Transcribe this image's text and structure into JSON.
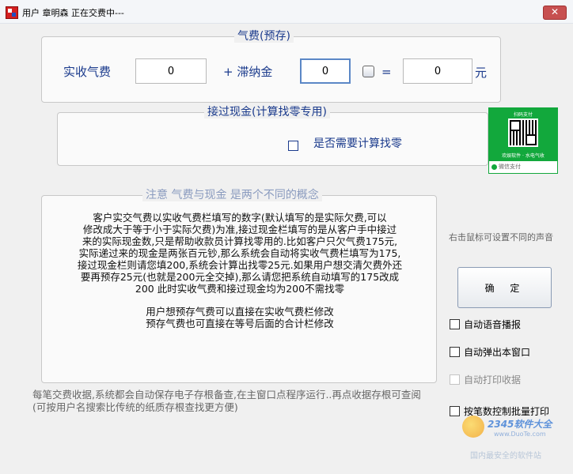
{
  "window": {
    "title": "用户 章明森 正在交费中---",
    "close_label": "✕"
  },
  "gas": {
    "group_title": "气费(预存)",
    "received_label": "实收气费",
    "received_value": "0",
    "late_fee_label": "+ 滞纳金",
    "late_fee_value": "0",
    "equals": "=",
    "total_value": "0",
    "unit": "元"
  },
  "cash": {
    "group_title": "接过现金(计算找零专用)",
    "change_label": "是否需要计算找零"
  },
  "qr": {
    "top_text": "扫码支付",
    "bottom_text": "欢娱软件 · 水电气收",
    "strip_text": "微信支付"
  },
  "notice": {
    "group_title": "注意 气费与现金 是两个不同的概念",
    "lines": [
      "客户实交气费以实收气费栏填写的数字(默认填写的是实际欠费,可以",
      "修改成大于等于小于实际欠费)为准,接过现金栏填写的是从客户手中接过",
      "来的实际现金数,只是帮助收款员计算找零用的.比如客户只欠气费175元,",
      "实际递过来的现金是两张百元钞,那么系统会自动将实收气费栏填写为175,",
      "接过现金栏则请您填200,系统会计算出找零25元.如果用户想交清欠费外还",
      "要再预存25元(也就是200元全交掉),那么请您把系统自动填写的175改成",
      "200 此时实收气费和接过现金均为200不需找零"
    ],
    "extra_lines": [
      "用户想预存气费可以直接在实收气费栏修改",
      "预存气费也可直接在等号后面的合计栏修改"
    ]
  },
  "footer": {
    "text": "每笔交费收据,系统都会自动保存电子存根备查,在主窗口点程序运行..再点收据存根可查阅(可按用户名搜索比传统的纸质存根查找更方便)"
  },
  "side": {
    "hint": "右击鼠标可设置不同的声音",
    "confirm_label": "确 定",
    "options": [
      {
        "label": "自动语音播报",
        "enabled": true
      },
      {
        "label": "自动弹出本窗口",
        "enabled": true
      },
      {
        "label": "自动打印收据",
        "enabled": false
      },
      {
        "label": "按笔数控制批量打印",
        "enabled": true
      }
    ]
  },
  "watermark": {
    "brand": "2345软件大全",
    "url": "www.DuoTe.com",
    "slogan": "国内最安全的软件站"
  }
}
